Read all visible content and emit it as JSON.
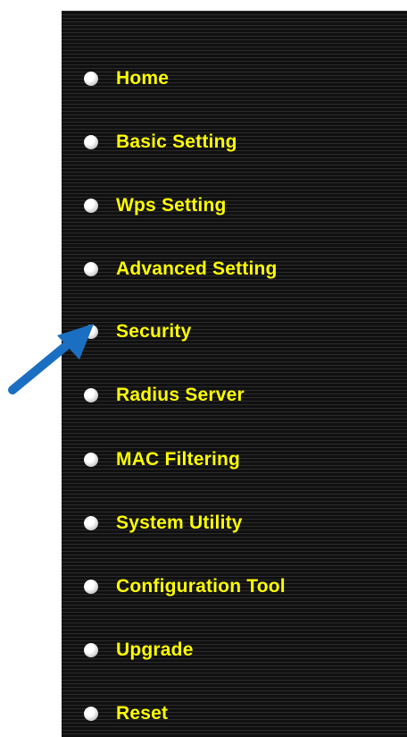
{
  "menu": {
    "items": [
      {
        "label": "Home",
        "icon": "bullet-icon"
      },
      {
        "label": "Basic Setting",
        "icon": "bullet-icon"
      },
      {
        "label": "Wps Setting",
        "icon": "bullet-icon"
      },
      {
        "label": "Advanced Setting",
        "icon": "bullet-icon"
      },
      {
        "label": "Security",
        "icon": "bullet-icon"
      },
      {
        "label": "Radius Server",
        "icon": "bullet-icon"
      },
      {
        "label": "MAC Filtering",
        "icon": "bullet-icon"
      },
      {
        "label": "System Utility",
        "icon": "bullet-icon"
      },
      {
        "label": "Configuration Tool",
        "icon": "bullet-icon"
      },
      {
        "label": "Upgrade",
        "icon": "bullet-icon"
      },
      {
        "label": "Reset",
        "icon": "bullet-icon"
      }
    ]
  },
  "annotation": {
    "pointer_target": "Security",
    "arrow_color": "#1b6fc2"
  },
  "colors": {
    "panel_background": "#151515",
    "label_text": "#ffff00",
    "bullet": "#ffffff"
  }
}
